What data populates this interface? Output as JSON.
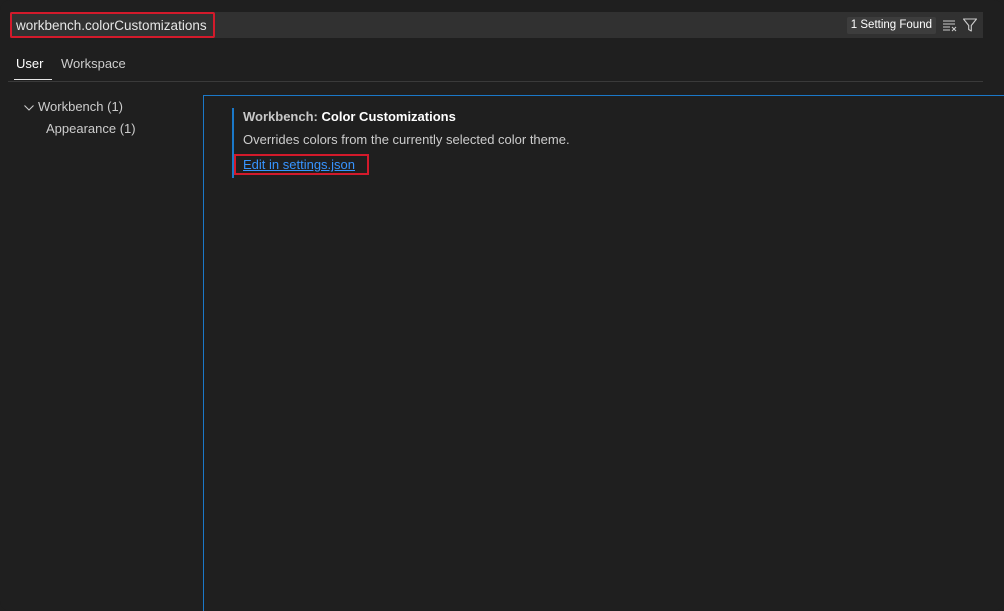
{
  "search": {
    "value": "workbench.colorCustomizations",
    "result_count": "1 Setting Found",
    "clear_icon": "clear-filter-icon",
    "filter_icon": "filter-icon"
  },
  "tabs": [
    {
      "label": "User",
      "active": true
    },
    {
      "label": "Workspace",
      "active": false
    }
  ],
  "tree": {
    "items": [
      {
        "label": "Workbench (1)",
        "expanded": true,
        "icon": "chevron-down-icon"
      },
      {
        "label": "Appearance (1)"
      }
    ]
  },
  "setting": {
    "category": "Workbench: ",
    "name": "Color Customizations",
    "description": "Overrides colors from the currently selected color theme.",
    "link_label": "Edit in settings.json"
  },
  "colors": {
    "background": "#1f1f1f",
    "accent": "#1b78c8",
    "link": "#3794ff",
    "highlight_box": "#d31a2b"
  }
}
